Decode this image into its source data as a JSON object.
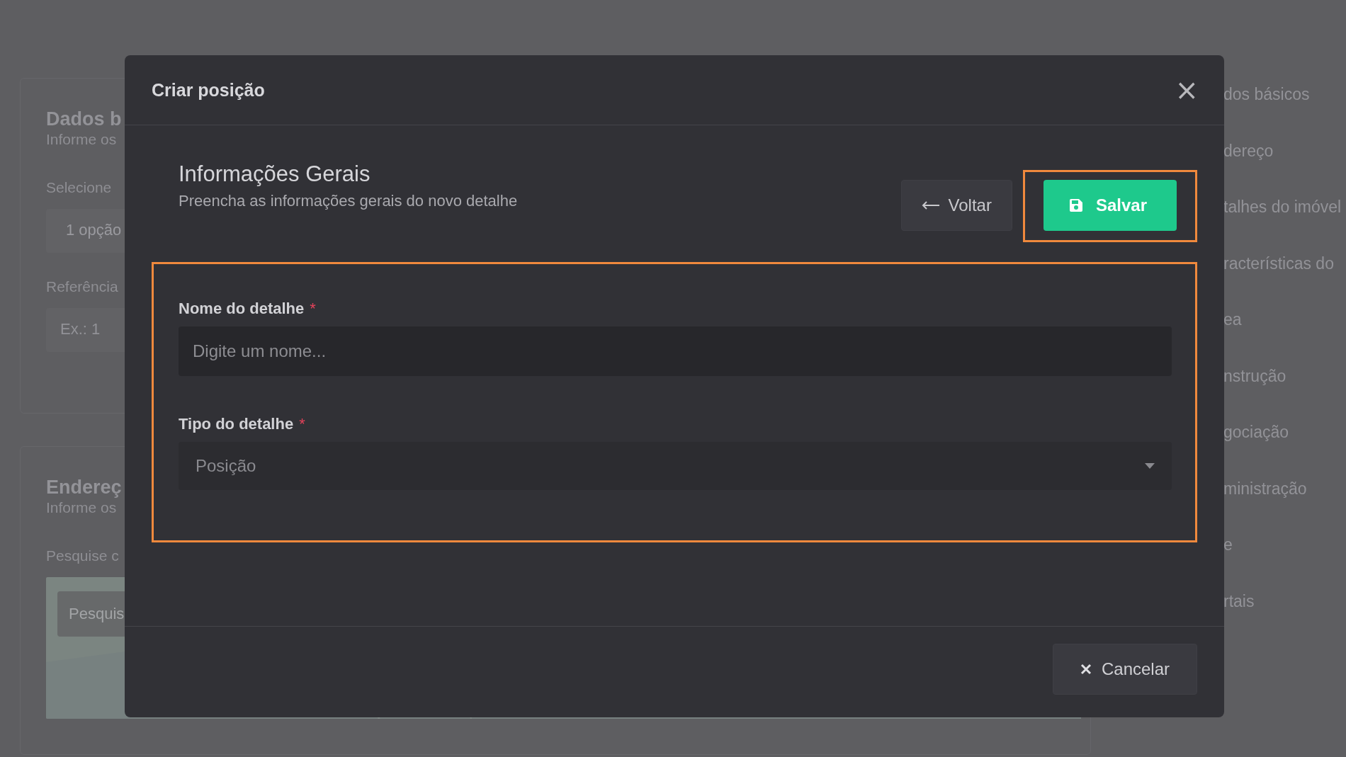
{
  "background": {
    "cards": [
      {
        "title": "Dados b",
        "subtitle": "Informe os",
        "fields": [
          {
            "label": "Selecione",
            "value": "1 opção"
          },
          {
            "label": "Referência",
            "placeholder": "Ex.: 1"
          }
        ]
      },
      {
        "title": "Endereç",
        "subtitle": "Informe os",
        "fields": [
          {
            "label": "Pesquise c"
          }
        ],
        "map": {
          "kind": "picture",
          "search_placeholder": "Pesquis"
        }
      }
    ],
    "nav": [
      "dos básicos",
      "dereço",
      "talhes do imóvel",
      "racterísticas do",
      "ea",
      "nstrução",
      "gociação",
      "ministração",
      "e",
      "rtais"
    ]
  },
  "modal": {
    "title": "Criar posição",
    "close": "×",
    "section": {
      "title": "Informações Gerais",
      "subtitle": "Preencha as informações gerais do novo detalhe"
    },
    "buttons": [
      {
        "kind": "back",
        "label": "Voltar",
        "highlighted": false
      },
      {
        "kind": "save",
        "label": "Salvar",
        "highlighted": true
      }
    ],
    "form": {
      "highlighted": true,
      "fields": [
        {
          "kind": "text",
          "label": "Nome do detalhe",
          "required_mark": "*",
          "placeholder": "Digite um nome..."
        },
        {
          "kind": "select",
          "label": "Tipo do detalhe",
          "required_mark": "*",
          "value": "Posição"
        }
      ]
    },
    "footer": {
      "cancel": "Cancelar"
    }
  }
}
